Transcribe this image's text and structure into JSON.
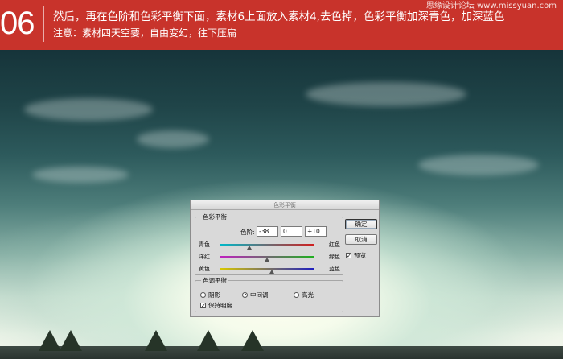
{
  "banner": {
    "step": "06",
    "line1": "然后，再在色阶和色彩平衡下面，素材6上面放入素材4,去色掉，色彩平衡加深青色，加深蓝色",
    "line2": "注意：素材四天空要，自由变幻，往下压扁",
    "watermark": "思缘设计论坛 www.missyuan.com"
  },
  "dialog": {
    "title": "色彩平衡",
    "color_balance": {
      "group_title": "色彩平衡",
      "levels_label": "色阶:",
      "levels": [
        "-38",
        "0",
        "+10"
      ],
      "sliders": [
        {
          "left": "青色",
          "right": "红色",
          "value": -38,
          "colors": [
            "#00b8c8",
            "#d02020"
          ]
        },
        {
          "left": "洋红",
          "right": "绿色",
          "value": 0,
          "colors": [
            "#c020c0",
            "#20b020"
          ]
        },
        {
          "left": "黄色",
          "right": "蓝色",
          "value": 10,
          "colors": [
            "#d8c800",
            "#2020c0"
          ]
        }
      ]
    },
    "tone_balance": {
      "group_title": "色调平衡",
      "options": [
        "阴影",
        "中间调",
        "高光"
      ],
      "selected": "中间调",
      "preserve_luminosity": "保持明度",
      "preserve_checked": true
    },
    "buttons": {
      "ok": "确定",
      "cancel": "取消"
    },
    "preview": {
      "label": "预览",
      "checked": true
    }
  }
}
